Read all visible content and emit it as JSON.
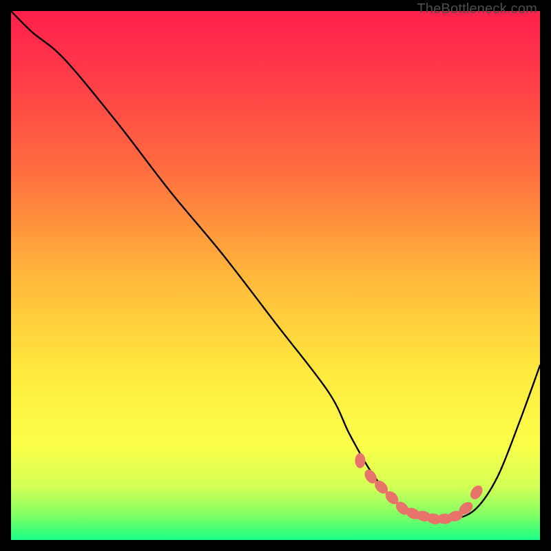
{
  "watermark": "TheBottleneck.com",
  "colors": {
    "frame": "#000000",
    "curve": "#000000",
    "marker_fill": "#e8736b",
    "marker_stroke": "#c94f45",
    "gradient_stops": [
      {
        "offset": 0.0,
        "color": "#ff1f4b"
      },
      {
        "offset": 0.12,
        "color": "#ff3b49"
      },
      {
        "offset": 0.3,
        "color": "#ff6d3f"
      },
      {
        "offset": 0.5,
        "color": "#ffb73b"
      },
      {
        "offset": 0.68,
        "color": "#ffe93f"
      },
      {
        "offset": 0.82,
        "color": "#fcff4a"
      },
      {
        "offset": 0.9,
        "color": "#d3ff55"
      },
      {
        "offset": 0.955,
        "color": "#7dff65"
      },
      {
        "offset": 1.0,
        "color": "#1aff86"
      }
    ]
  },
  "chart_data": {
    "type": "line",
    "title": "",
    "xlabel": "",
    "ylabel": "",
    "xlim": [
      0,
      100
    ],
    "ylim": [
      0,
      100
    ],
    "grid": false,
    "legend": false,
    "series": [
      {
        "name": "bottleneck-curve",
        "x": [
          0,
          4,
          10,
          20,
          30,
          40,
          50,
          60,
          64,
          68,
          72,
          76,
          80,
          84,
          88,
          92,
          96,
          100
        ],
        "y": [
          100,
          96,
          91,
          79,
          66,
          54,
          41,
          28,
          20,
          13,
          8,
          5,
          4,
          4,
          6,
          12,
          22,
          33
        ]
      }
    ],
    "highlighted_points": {
      "comment": "dotted segment near the trough",
      "x": [
        66,
        68,
        70,
        72,
        74,
        76,
        78,
        80,
        82,
        84,
        86,
        88
      ],
      "y": [
        15,
        12,
        10,
        8,
        6,
        5,
        4.5,
        4,
        4,
        4.5,
        6,
        9
      ]
    }
  }
}
